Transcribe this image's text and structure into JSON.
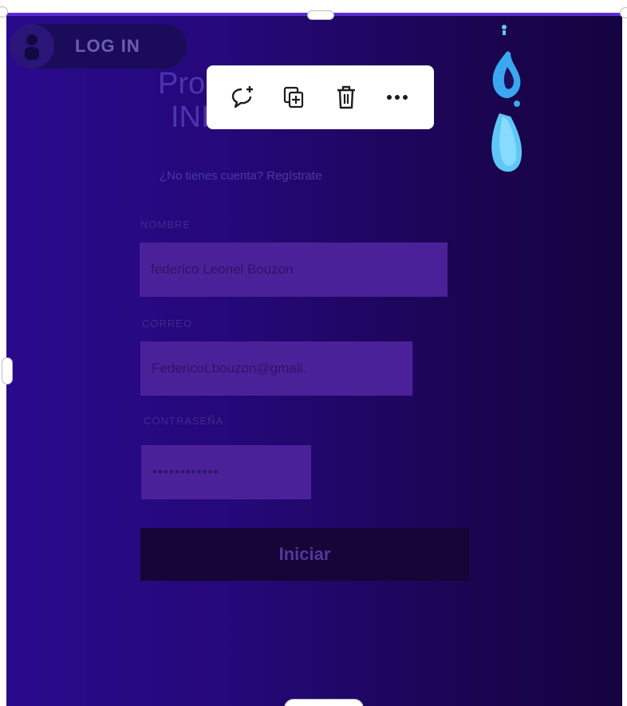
{
  "login": {
    "label": "LOG IN"
  },
  "form": {
    "title_line1": "Pro",
    "title_line2": "INICIA SESION",
    "subtitle": "¿No tienes cuenta? Regístrate",
    "name_label": "NOMBRE",
    "name_value": "federico Leonel Bouzon",
    "email_label": "CORREO",
    "email_value": "FedericoLbouzon@gmail.",
    "password_label": "CONTRASEÑA",
    "password_value": "••••••••••••",
    "submit_label": "Iniciar"
  },
  "toolbar": {
    "items": [
      {
        "icon": "comment-add-icon"
      },
      {
        "icon": "duplicate-icon"
      },
      {
        "icon": "trash-icon"
      },
      {
        "icon": "more-icon"
      }
    ]
  },
  "colors": {
    "background_start": "#2a0a8c",
    "background_end": "#14033f",
    "input_fill": "#4b2199",
    "button_fill": "#160537",
    "flame_blue": "#5fc7f7"
  }
}
